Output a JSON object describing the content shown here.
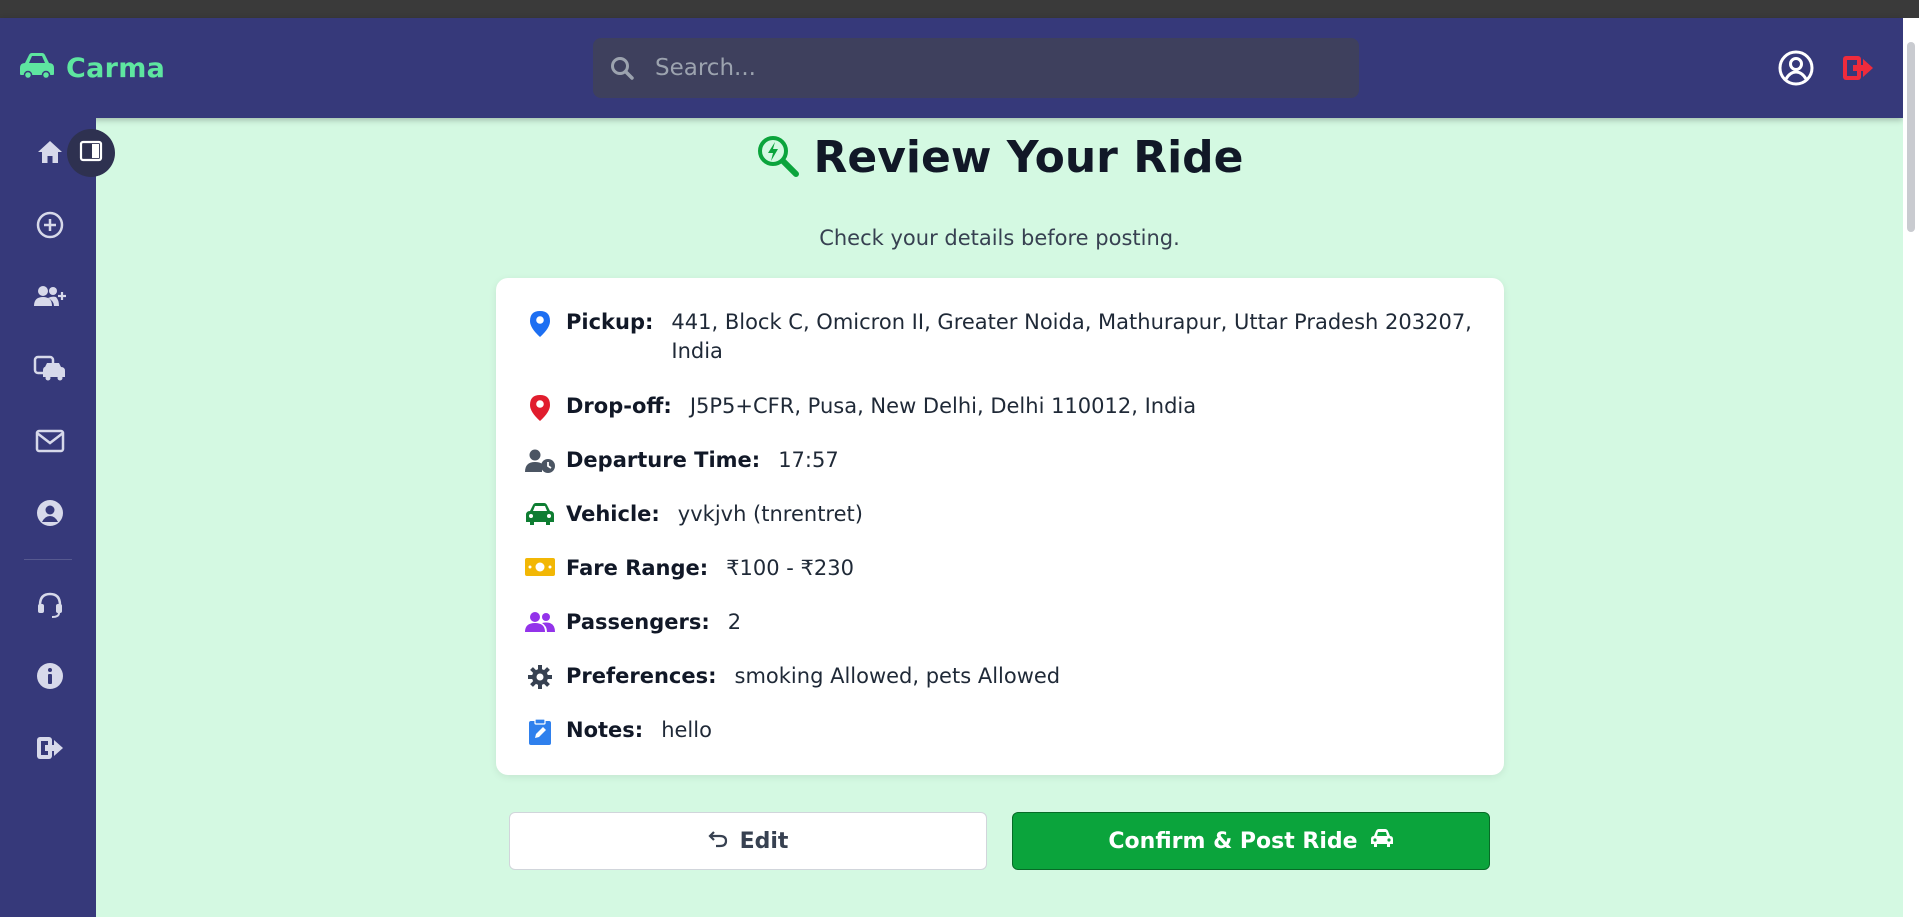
{
  "app": {
    "name": "Carma"
  },
  "search": {
    "placeholder": "Search..."
  },
  "page": {
    "title": "Review Your Ride",
    "subtitle": "Check your details before posting."
  },
  "details": {
    "pickup": {
      "label": "Pickup:",
      "value": "441, Block C, Omicron II, Greater Noida, Mathurapur, Uttar Pradesh 203207, India"
    },
    "dropoff": {
      "label": "Drop-off:",
      "value": "J5P5+CFR, Pusa, New Delhi, Delhi 110012, India"
    },
    "departure": {
      "label": "Departure Time:",
      "value": "17:57"
    },
    "vehicle": {
      "label": "Vehicle:",
      "value": "yvkjvh (tnrentret)"
    },
    "fare": {
      "label": "Fare Range:",
      "value": "₹100 - ₹230"
    },
    "passengers": {
      "label": "Passengers:",
      "value": "2"
    },
    "preferences": {
      "label": "Preferences:",
      "value": "smoking Allowed, pets Allowed"
    },
    "notes": {
      "label": "Notes:",
      "value": "hello"
    }
  },
  "actions": {
    "edit_label": "Edit",
    "confirm_label": "Confirm & Post Ride"
  },
  "sidebar": {
    "items": [
      "home-icon",
      "add-circle-icon",
      "add-user-icon",
      "ride-icon",
      "mail-icon",
      "profile-icon",
      "support-icon",
      "info-icon",
      "logout-icon"
    ]
  },
  "colors": {
    "navbar": "#36397a",
    "brand": "#5ee6a0",
    "background": "#d4f9e2",
    "confirm": "#0ba43c",
    "logout": "#ef2b3c"
  }
}
